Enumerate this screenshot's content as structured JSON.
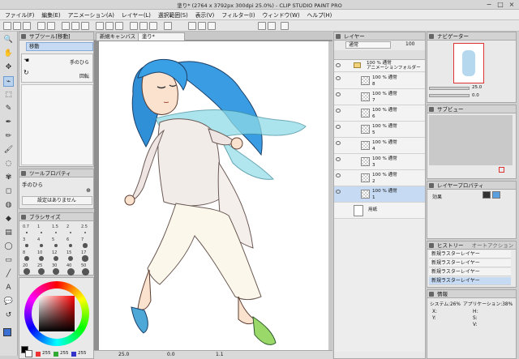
{
  "window": {
    "title": "塗り* (2764 x 3792px 300dpi 25.0%)  - CLIP STUDIO PAINT PRO",
    "minimize": "−",
    "maximize": "□",
    "close": "×"
  },
  "menu": [
    "ファイル(F)",
    "編集(E)",
    "アニメーション(A)",
    "レイヤー(L)",
    "選択範囲(S)",
    "表示(V)",
    "フィルター(I)",
    "ウィンドウ(W)",
    "ヘルプ(H)"
  ],
  "tools": {
    "icons": [
      "zoom-icon",
      "hand-icon",
      "move-icon",
      "lasso-icon",
      "selection-icon",
      "eyedropper-icon",
      "pen-icon",
      "pencil-icon",
      "brush-icon",
      "airbrush-icon",
      "decoration-icon",
      "eraser-icon",
      "blend-icon",
      "fill-icon",
      "gradient-icon",
      "figure-icon",
      "frame-icon",
      "ruler-icon",
      "text-icon",
      "balloon-icon",
      "correction-icon"
    ],
    "glyphs": [
      "🔍",
      "✋",
      "✥",
      "⌁",
      "⬚",
      "✎",
      "✒",
      "✏",
      "🖌",
      "◌",
      "✾",
      "◻",
      "◍",
      "◆",
      "▤",
      "◯",
      "▭",
      "╱",
      "A",
      "💬",
      "↺"
    ],
    "selected_index": 3
  },
  "subtool": {
    "header": "サブツール[移動]",
    "items": [
      {
        "label": "移動",
        "right": ""
      },
      {
        "label": "",
        "right": "手のひら"
      },
      {
        "label": "",
        "right": "回転"
      }
    ]
  },
  "tool_property": {
    "header": "ツールプロパティ",
    "name": "手のひら",
    "button": "設定はありません"
  },
  "brush_size": {
    "header": "ブラシサイズ",
    "sizes": [
      "0.7",
      "1",
      "1.5",
      "2",
      "2.5",
      "3",
      "4",
      "5",
      "6",
      "7",
      "8",
      "10",
      "12",
      "15",
      "17",
      "20",
      "25",
      "30",
      "40",
      "50"
    ]
  },
  "color": {
    "main_hex": "#ff0000",
    "values": {
      "r": "255",
      "g": "255",
      "b": "255"
    }
  },
  "canvas": {
    "tabs": [
      "新規キャンバス",
      "塗り*"
    ],
    "zoom": "25.0",
    "rotation": "0.0",
    "coords": "1.1"
  },
  "layers": {
    "header": "レイヤー",
    "blend_mode": "通常",
    "opacity": "100",
    "folder": {
      "percent": "100 %  通常",
      "name": "アニメーションフォルダー"
    },
    "rows": [
      {
        "percent": "100 %  通常",
        "name": "8"
      },
      {
        "percent": "100 %  通常",
        "name": "7"
      },
      {
        "percent": "100 %  通常",
        "name": "6"
      },
      {
        "percent": "100 %  通常",
        "name": "5"
      },
      {
        "percent": "100 %  通常",
        "name": "4"
      },
      {
        "percent": "100 %  通常",
        "name": "3"
      },
      {
        "percent": "100 %  通常",
        "name": "2"
      },
      {
        "percent": "100 %  通常",
        "name": "1"
      }
    ],
    "paper": "用紙"
  },
  "navigator": {
    "header": "ナビゲーター",
    "zoom": "25.0",
    "angle": "0.0"
  },
  "sub_view": {
    "header": "サブビュー"
  },
  "layer_property": {
    "header": "レイヤープロパティ",
    "effect_label": "効果"
  },
  "history": {
    "header": "ヒストリー",
    "header2": "オートアクション",
    "items": [
      "新規ラスターレイヤー",
      "新規ラスターレイヤー",
      "新規ラスターレイヤー",
      "新規ラスターレイヤー"
    ],
    "selected_index": 3
  },
  "info": {
    "header": "情報",
    "system": "システム:26%",
    "app": "アプリケーション:38%",
    "x_label": "X:",
    "y_label": "Y:",
    "h_label": "H:",
    "s_label": "S:",
    "v_label": "V:"
  }
}
